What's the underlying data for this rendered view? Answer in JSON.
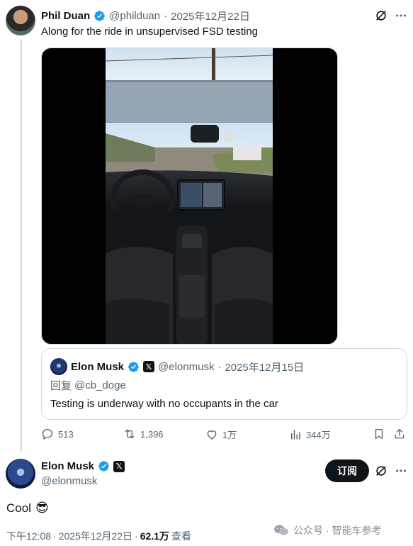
{
  "reply_post": {
    "author_name": "Phil Duan",
    "author_handle": "@philduan",
    "separator": "·",
    "date": "2025年12月22日",
    "text": "Along for the ride in unsupervised FSD testing",
    "media_type": "video"
  },
  "quoted_post": {
    "author_name": "Elon Musk",
    "author_handle": "@elonmusk",
    "separator": "·",
    "date": "2025年12月15日",
    "reply_prefix": "回复",
    "reply_to": "@cb_doge",
    "text": "Testing is underway with no occupants in the car"
  },
  "actions": {
    "replies": "513",
    "reposts": "1,396",
    "likes": "1万",
    "views": "344万"
  },
  "main_post": {
    "author_name": "Elon Musk",
    "author_handle": "@elonmusk",
    "subscribe_label": "订阅",
    "text": "Cool",
    "emoji": "😎",
    "time": "下午12:08",
    "separator": "·",
    "date": "2025年12月22日",
    "view_count": "62.1万",
    "view_label": "查看"
  },
  "watermark": {
    "text": "公众号 · 智能车参考"
  },
  "colors": {
    "verified_blue": "#1d9bf0",
    "text_primary": "#0f1419",
    "text_secondary": "#536471",
    "border": "#cfd9de"
  },
  "icons": [
    "grok-icon",
    "more-icon",
    "reply-icon",
    "repost-icon",
    "like-icon",
    "views-icon",
    "bookmark-icon",
    "share-icon",
    "verified-badge-icon",
    "x-affiliate-icon",
    "wechat-icon"
  ]
}
